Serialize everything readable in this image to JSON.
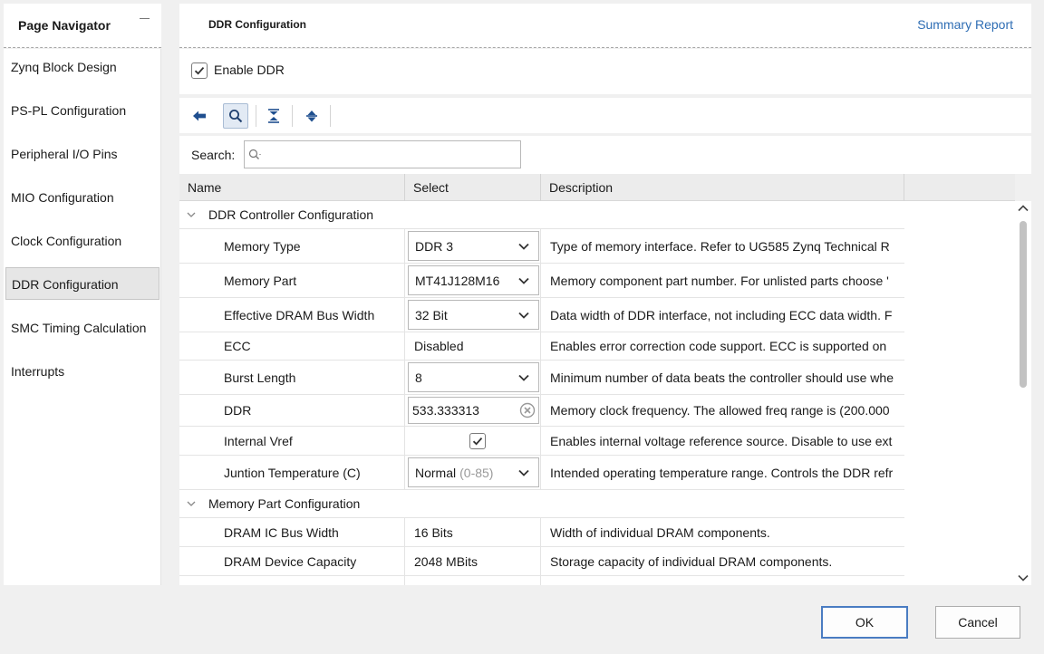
{
  "navigator": {
    "title": "Page Navigator",
    "items": [
      {
        "label": "Zynq Block Design",
        "selected": false
      },
      {
        "label": "PS-PL Configuration",
        "selected": false
      },
      {
        "label": "Peripheral I/O Pins",
        "selected": false
      },
      {
        "label": "MIO Configuration",
        "selected": false
      },
      {
        "label": "Clock Configuration",
        "selected": false
      },
      {
        "label": "DDR Configuration",
        "selected": true
      },
      {
        "label": "SMC Timing Calculation",
        "selected": false
      },
      {
        "label": "Interrupts",
        "selected": false
      }
    ]
  },
  "header": {
    "title": "DDR Configuration",
    "summary_link": "Summary Report"
  },
  "enable_ddr": {
    "label": "Enable DDR",
    "checked": true
  },
  "toolbar": {
    "buttons": [
      "back-icon",
      "search-icon",
      "collapse-all-icon",
      "expand-all-icon"
    ]
  },
  "search": {
    "label": "Search:",
    "value": "",
    "placeholder": ""
  },
  "table": {
    "columns": [
      "Name",
      "Select",
      "Description"
    ],
    "groups": [
      {
        "label": "DDR Controller Configuration",
        "rows": [
          {
            "name": "Memory Type",
            "kind": "combo",
            "value": "DDR 3",
            "description": "Type of memory interface. Refer to UG585 Zynq Technical R"
          },
          {
            "name": "Memory Part",
            "kind": "combo",
            "value": "MT41J128M16",
            "description": "Memory component part number. For unlisted parts choose '"
          },
          {
            "name": "Effective DRAM Bus Width",
            "kind": "combo",
            "value": "32 Bit",
            "description": "Data width of DDR interface, not including ECC data width. F"
          },
          {
            "name": "ECC",
            "kind": "text",
            "value": "Disabled",
            "description": "Enables error correction code support. ECC is supported on"
          },
          {
            "name": "Burst Length",
            "kind": "combo",
            "value": "8",
            "description": "Minimum number of data beats the controller should use whe"
          },
          {
            "name": "DDR",
            "kind": "field",
            "value": "533.333313",
            "description": "Memory clock frequency. The allowed freq range is (200.000"
          },
          {
            "name": "Internal Vref",
            "kind": "check",
            "value": "true",
            "description": "Enables internal voltage reference source. Disable to use ext"
          },
          {
            "name": "Juntion Temperature (C)",
            "kind": "combo",
            "value": "Normal",
            "hint": "(0-85)",
            "description": "Intended operating temperature range. Controls the DDR refr"
          }
        ]
      },
      {
        "label": "Memory Part Configuration",
        "rows": [
          {
            "name": "DRAM IC Bus Width",
            "kind": "text",
            "value": "16 Bits",
            "description": "Width of individual DRAM components."
          },
          {
            "name": "DRAM Device Capacity",
            "kind": "text",
            "value": "2048 MBits",
            "description": "Storage capacity of individual DRAM components."
          }
        ]
      }
    ]
  },
  "footer": {
    "ok": "OK",
    "cancel": "Cancel"
  }
}
